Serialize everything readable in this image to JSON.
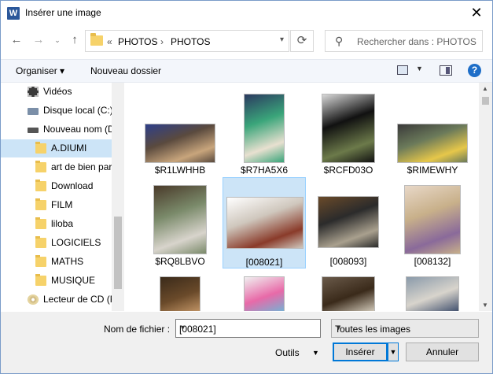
{
  "window": {
    "title": "Insérer une image",
    "app_icon_letter": "W"
  },
  "address": {
    "overflow": "«",
    "crumbs": [
      "PHOTOS",
      "PHOTOS"
    ],
    "separator": "›"
  },
  "search": {
    "placeholder": "Rechercher dans : PHOTOS"
  },
  "toolbar": {
    "organize": "Organiser ▾",
    "new_folder": "Nouveau dossier",
    "help": "?"
  },
  "tree": {
    "items": [
      {
        "label": "Vidéos",
        "icon": "video-icon"
      },
      {
        "label": "Disque local (C:)",
        "icon": "drive-icon"
      },
      {
        "label": "Nouveau nom (D:)",
        "icon": "drive-icon"
      },
      {
        "label": "A.DIUMI",
        "icon": "folder-icon",
        "selected": true
      },
      {
        "label": "art de bien parler",
        "icon": "folder-icon"
      },
      {
        "label": "Download",
        "icon": "folder-icon"
      },
      {
        "label": "FILM",
        "icon": "folder-icon"
      },
      {
        "label": "liloba",
        "icon": "folder-icon"
      },
      {
        "label": "LOGICIELS",
        "icon": "folder-icon"
      },
      {
        "label": "MATHS",
        "icon": "folder-icon"
      },
      {
        "label": "MUSIQUE",
        "icon": "folder-icon"
      },
      {
        "label": "Lecteur de CD (F:)",
        "icon": "cd-icon"
      }
    ]
  },
  "files": [
    {
      "name": "$R1LWHHB",
      "colors": [
        "#5a4a3e",
        "#c8a57c",
        "#2e3f8a"
      ]
    },
    {
      "name": "$R7HA5X6",
      "colors": [
        "#3aa57a",
        "#e8e0d0",
        "#2b3a60"
      ]
    },
    {
      "name": "$RCFD03O",
      "colors": [
        "#111111",
        "#6c7a4a",
        "#d8d8d8"
      ]
    },
    {
      "name": "$RIMEWHY",
      "colors": [
        "#6b7a5a",
        "#e6c74a",
        "#3a3a3a"
      ]
    },
    {
      "name": "$RQ8LBVO",
      "colors": [
        "#7a8a6a",
        "#d8d4cc",
        "#4a3a2a"
      ]
    },
    {
      "name": "[008021]",
      "colors": [
        "#cfc7bd",
        "#8a3b2a",
        "#ffffff"
      ],
      "selected": true
    },
    {
      "name": "[008093]",
      "colors": [
        "#2b2b2b",
        "#a9a08e",
        "#6a4a2a"
      ]
    },
    {
      "name": "[008132]",
      "colors": [
        "#c8b08a",
        "#8a6a9a",
        "#e8d8c8"
      ]
    },
    {
      "name": "",
      "colors": [
        "#6a4a2a",
        "#c89a6a",
        "#3a2a1a"
      ]
    },
    {
      "name": "",
      "colors": [
        "#e86aa8",
        "#6ab8d8",
        "#f0f0f0"
      ]
    },
    {
      "name": "",
      "colors": [
        "#3a2a1a",
        "#d8d0c0",
        "#6a5a4a"
      ]
    },
    {
      "name": "",
      "colors": [
        "#d8d4cc",
        "#3a4a6a",
        "#8a9aaa"
      ]
    }
  ],
  "bottom": {
    "filename_label": "Nom de fichier :",
    "filename_value": "[008021]",
    "type_value": "Toutes les images",
    "tools": "Outils",
    "insert": "Insérer",
    "cancel": "Annuler"
  }
}
